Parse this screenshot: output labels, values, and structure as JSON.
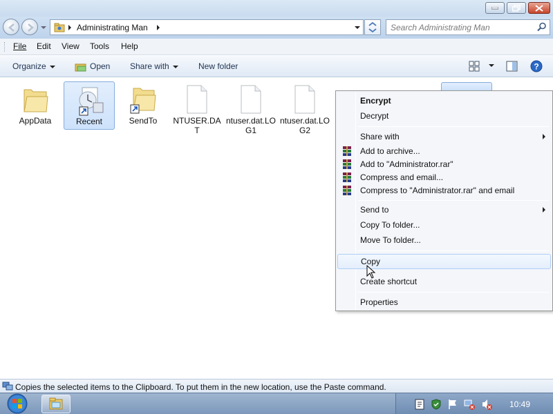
{
  "window": {
    "address_segment": "Administrating Man",
    "search_placeholder": "Search Administrating Man"
  },
  "menubar": [
    {
      "label": "File",
      "accelerator": "F"
    },
    {
      "label": "Edit",
      "accelerator": "E"
    },
    {
      "label": "View",
      "accelerator": "V"
    },
    {
      "label": "Tools",
      "accelerator": "T"
    },
    {
      "label": "Help",
      "accelerator": "H"
    }
  ],
  "toolbar": {
    "organize": "Organize",
    "open": "Open",
    "share_with": "Share with",
    "new_folder": "New folder"
  },
  "files": [
    {
      "name": "AppData",
      "icon": "folder-icon"
    },
    {
      "name": "Recent",
      "icon": "recent-shortcut-icon",
      "selected": true
    },
    {
      "name": "SendTo",
      "icon": "folder-shortcut-icon"
    },
    {
      "name": "NTUSER.DAT",
      "icon": "file-icon"
    },
    {
      "name": "ntuser.dat.LOG1",
      "icon": "file-icon"
    },
    {
      "name": "ntuser.dat.LOG2",
      "icon": "file-icon"
    }
  ],
  "context_menu": {
    "encrypt": "Encrypt",
    "decrypt": "Decrypt",
    "share_with": "Share with",
    "add_to_archive": "Add to archive...",
    "add_to_rar": "Add to \"Administrator.rar\"",
    "compress_email": "Compress and email...",
    "compress_rar_email": "Compress to \"Administrator.rar\" and email",
    "send_to": "Send to",
    "copy_to_folder": "Copy To folder...",
    "move_to_folder": "Move To folder...",
    "copy": "Copy",
    "create_shortcut": "Create shortcut",
    "properties": "Properties"
  },
  "statusbar": {
    "text": "Copies the selected items to the Clipboard. To put them in the new location, use the Paste command."
  },
  "taskbar": {
    "clock": "10:49"
  },
  "colors": {
    "accent": "#cde2fb",
    "selection_border": "#84acdd",
    "menu_bg": "#f4f6fa",
    "taskbar": "#7c98bb"
  }
}
